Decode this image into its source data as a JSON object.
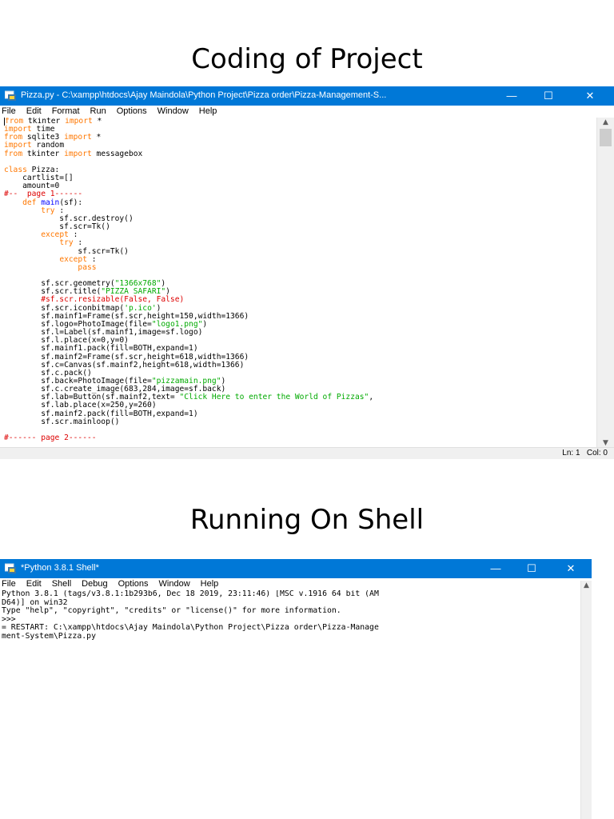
{
  "slide": {
    "title1": "Coding of Project",
    "title2": "Running On Shell"
  },
  "editor_window": {
    "title": "Pizza.py - C:\\xampp\\htdocs\\Ajay Maindola\\Python Project\\Pizza order\\Pizza-Management-S...",
    "controls": {
      "minimize": "—",
      "maximize": "☐",
      "close": "✕"
    },
    "menu": [
      "File",
      "Edit",
      "Format",
      "Run",
      "Options",
      "Window",
      "Help"
    ],
    "status": {
      "line": "Ln: 1",
      "col": "Col: 0"
    },
    "code": [
      [
        [
          "kw",
          "from"
        ],
        [
          "",
          "tkinter "
        ],
        [
          "kw",
          "import"
        ],
        [
          "",
          "*"
        ]
      ],
      [
        [
          "kw",
          "import"
        ],
        [
          "",
          "time"
        ]
      ],
      [
        [
          "kw",
          "from"
        ],
        [
          "",
          "sqlite3 "
        ],
        [
          "kw",
          "import"
        ],
        [
          "",
          "*"
        ]
      ],
      [
        [
          "kw",
          "import"
        ],
        [
          "",
          "random"
        ]
      ],
      [
        [
          "kw",
          "from"
        ],
        [
          "",
          "tkinter "
        ],
        [
          "kw",
          "import"
        ],
        [
          "",
          "messagebox"
        ]
      ],
      [],
      [
        [
          "kw",
          "class"
        ],
        [
          "",
          "Pizza:"
        ]
      ],
      [
        [
          "",
          "    cartlist=[]"
        ]
      ],
      [
        [
          "",
          "    amount=0"
        ]
      ],
      [
        [
          "cm",
          "#--  page 1------"
        ]
      ],
      [
        [
          "",
          "    "
        ],
        [
          "kw",
          "def"
        ],
        [
          "df",
          "main"
        ],
        [
          "",
          "(sf):"
        ]
      ],
      [
        [
          "",
          "        "
        ],
        [
          "kw",
          "try"
        ],
        [
          "",
          ":"
        ]
      ],
      [
        [
          "",
          "            sf.scr.destroy()"
        ]
      ],
      [
        [
          "",
          "            sf.scr=Tk()"
        ]
      ],
      [
        [
          "",
          "        "
        ],
        [
          "kw",
          "except"
        ],
        [
          "",
          ":"
        ]
      ],
      [
        [
          "",
          "            "
        ],
        [
          "kw",
          "try"
        ],
        [
          "",
          ":"
        ]
      ],
      [
        [
          "",
          "                sf.scr=Tk()"
        ]
      ],
      [
        [
          "",
          "            "
        ],
        [
          "kw",
          "except"
        ],
        [
          "",
          ":"
        ]
      ],
      [
        [
          "",
          "                "
        ],
        [
          "kw",
          "pass"
        ]
      ],
      [],
      [
        [
          "",
          "        sf.scr.geometry("
        ],
        [
          "st",
          "\"1366x768\""
        ],
        [
          "",
          ")"
        ]
      ],
      [
        [
          "",
          "        sf.scr.title("
        ],
        [
          "st",
          "\"PIZZA SAFARI\""
        ],
        [
          "",
          ")"
        ]
      ],
      [
        [
          "cm",
          "        #sf.scr.resizable(False, False)"
        ]
      ],
      [
        [
          "",
          "        sf.scr.iconbitmap("
        ],
        [
          "st",
          "'p.ico'"
        ],
        [
          "",
          ")"
        ]
      ],
      [
        [
          "",
          "        sf.mainf1=Frame(sf.scr,height=150,width=1366)"
        ]
      ],
      [
        [
          "",
          "        sf.logo=PhotoImage(file="
        ],
        [
          "st",
          "\"logo1.png\""
        ],
        [
          "",
          ")"
        ]
      ],
      [
        [
          "",
          "        sf.l=Label(sf.mainf1,image=sf.logo)"
        ]
      ],
      [
        [
          "",
          "        sf.l.place(x=0,y=0)"
        ]
      ],
      [
        [
          "",
          "        sf.mainf1.pack(fill=BOTH,expand=1)"
        ]
      ],
      [
        [
          "",
          "        sf.mainf2=Frame(sf.scr,height=618,width=1366)"
        ]
      ],
      [
        [
          "",
          "        sf.c=Canvas(sf.mainf2,height=618,width=1366)"
        ]
      ],
      [
        [
          "",
          "        sf.c.pack()"
        ]
      ],
      [
        [
          "",
          "        sf.back=PhotoImage(file="
        ],
        [
          "st",
          "\"pizzamain.png\""
        ],
        [
          "",
          ")"
        ]
      ],
      [
        [
          "",
          "        sf.c.create_image(683,284,image=sf.back)"
        ]
      ],
      [
        [
          "",
          "        sf.lab=Button(sf.mainf2,text= "
        ],
        [
          "st",
          "\"Click Here to enter the World of Pizzas\""
        ],
        [
          "",
          ","
        ]
      ],
      [
        [
          "",
          "        sf.lab.place(x=250,y=260)"
        ]
      ],
      [
        [
          "",
          "        sf.mainf2.pack(fill=BOTH,expand=1)"
        ]
      ],
      [
        [
          "",
          "        sf.scr.mainloop()"
        ]
      ],
      [],
      [
        [
          "cm",
          "#------ page 2------"
        ]
      ]
    ]
  },
  "shell_window": {
    "title": "*Python 3.8.1 Shell*",
    "controls": {
      "minimize": "—",
      "maximize": "☐",
      "close": "✕"
    },
    "menu": [
      "File",
      "Edit",
      "Shell",
      "Debug",
      "Options",
      "Window",
      "Help"
    ],
    "lines": [
      "Python 3.8.1 (tags/v3.8.1:1b293b6, Dec 18 2019, 23:11:46) [MSC v.1916 64 bit (AM",
      "D64)] on win32",
      "Type \"help\", \"copyright\", \"credits\" or \"license()\" for more information.",
      ">>>",
      "= RESTART: C:\\xampp\\htdocs\\Ajay Maindola\\Python Project\\Pizza order\\Pizza-Manage",
      "ment-System\\Pizza.py"
    ]
  },
  "colors": {
    "titlebar": "#0078d7",
    "keyword": "#ff7700",
    "comment": "#dd0000",
    "string": "#00aa00",
    "definition": "#0000ff"
  }
}
